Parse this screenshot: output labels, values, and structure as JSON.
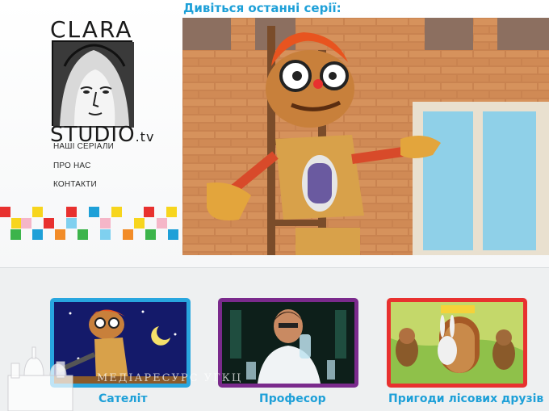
{
  "logo": {
    "line1": "CLARA",
    "line2": "STUDIO",
    "suffix": ".tv"
  },
  "nav": {
    "items": [
      "НАШІ СЕРІАЛИ",
      "ПРО НАС",
      "КОНТАКТИ"
    ]
  },
  "hero": {
    "title": "Дивіться останні серії:"
  },
  "cards": [
    {
      "title": "Сателіт",
      "border_color": "#28a6df"
    },
    {
      "title": "Професор",
      "border_color": "#7a2a8c"
    },
    {
      "title": "Пригоди лісових друзів",
      "border_color": "#e8312f"
    }
  ],
  "colors": {
    "accent": "#1ea0d8"
  },
  "watermark": "МЕДІАРЕСУРС УГКЦ"
}
